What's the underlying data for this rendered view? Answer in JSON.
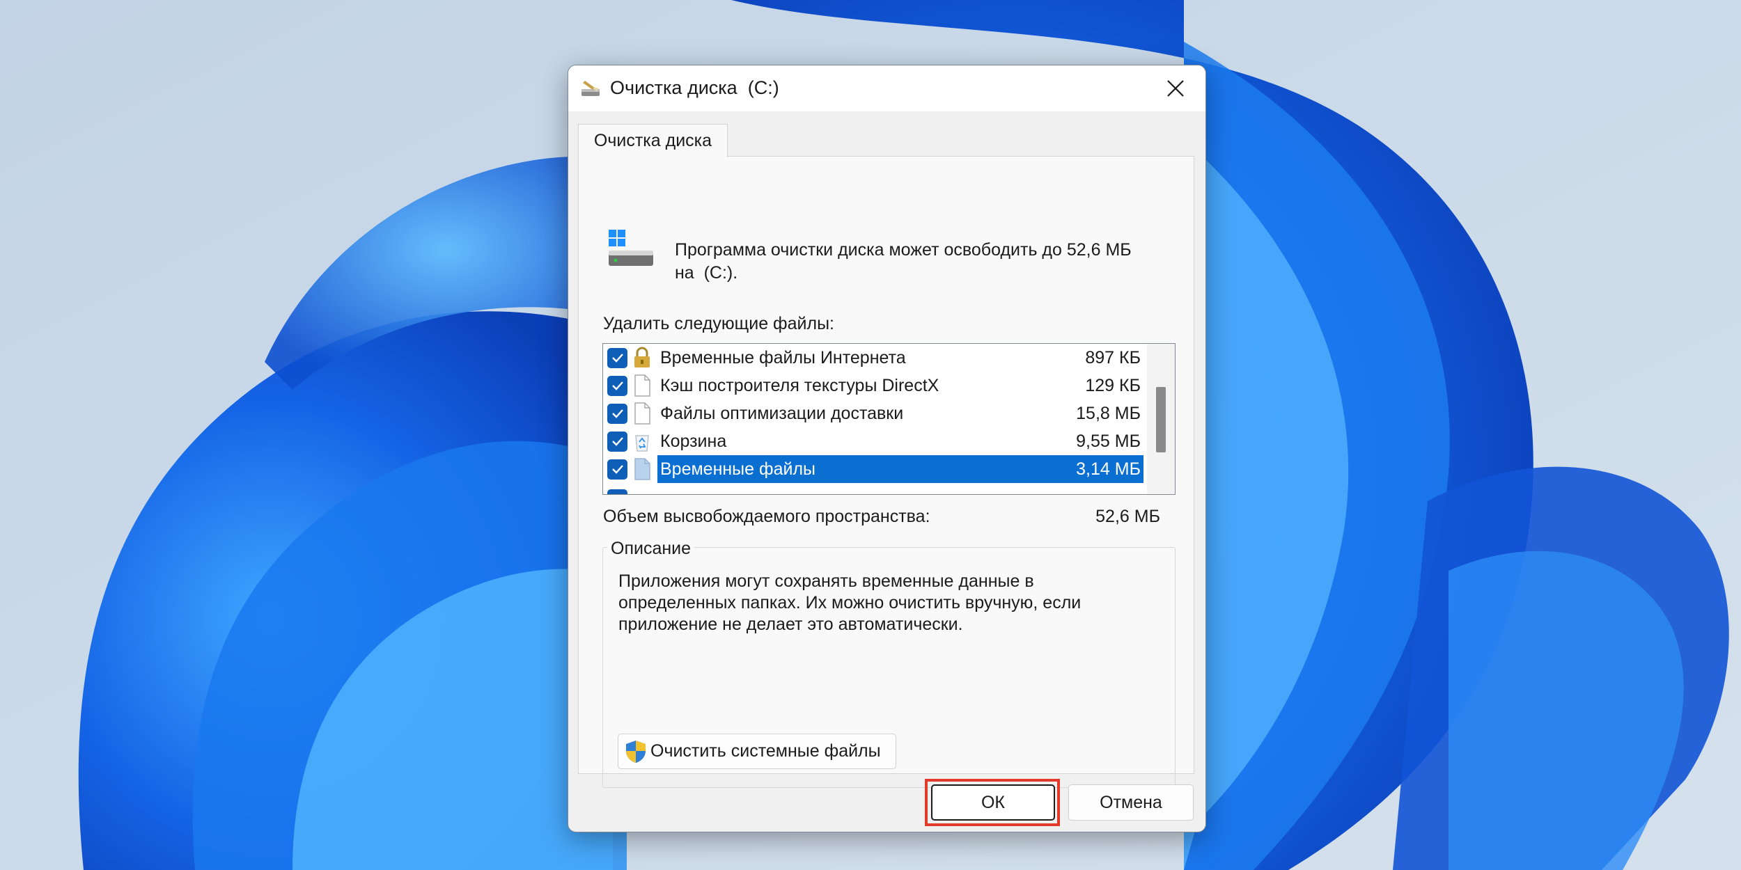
{
  "window": {
    "title": "Очистка диска  (C:)",
    "icon": "disk-cleanup-icon"
  },
  "tab": {
    "label": "Очистка диска"
  },
  "intro": {
    "line1": "Программа очистки диска может освободить до 52,6 МБ",
    "line2": "на  (C:)."
  },
  "list": {
    "label": "Удалить следующие файлы:",
    "items": [
      {
        "name": "Временные файлы Интернета",
        "size": "897 КБ",
        "checked": true,
        "icon": "lock-icon",
        "selected": false
      },
      {
        "name": "Кэш построителя текстуры DirectX",
        "size": "129 КБ",
        "checked": true,
        "icon": "file-icon",
        "selected": false
      },
      {
        "name": "Файлы оптимизации доставки",
        "size": "15,8 МБ",
        "checked": true,
        "icon": "file-icon",
        "selected": false
      },
      {
        "name": "Корзина",
        "size": "9,55 МБ",
        "checked": true,
        "icon": "recycle-bin-icon",
        "selected": false
      },
      {
        "name": "Временные файлы",
        "size": "3,14 МБ",
        "checked": true,
        "icon": "file-icon",
        "selected": true
      }
    ]
  },
  "space": {
    "label": "Объем высвобождаемого пространства:",
    "value": "52,6 МБ"
  },
  "description": {
    "legend": "Описание",
    "line1": "Приложения могут сохранять временные данные в",
    "line2": "определенных папках. Их можно очистить вручную, если",
    "line3": "приложение не делает это автоматически."
  },
  "buttons": {
    "cleanup_system": "Очистить системные файлы",
    "ok": "ОК",
    "cancel": "Отмена"
  },
  "colors": {
    "accent": "#0a6fd1",
    "checkbox": "#0f5fb8",
    "highlight": "#e23b2a"
  }
}
